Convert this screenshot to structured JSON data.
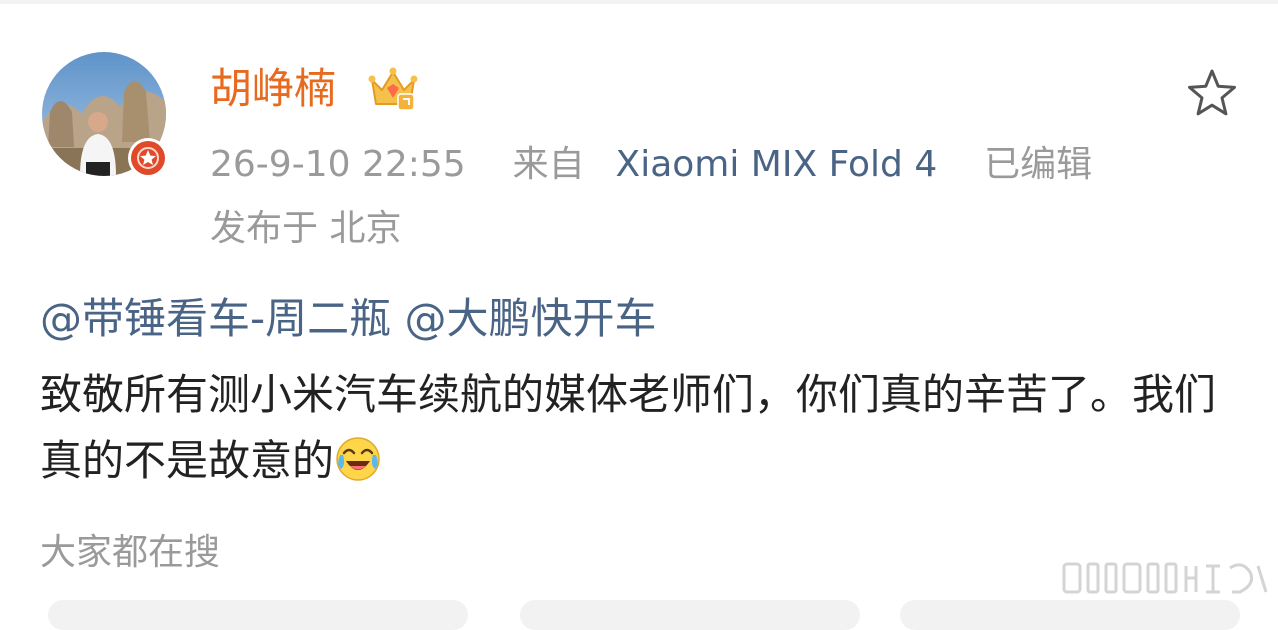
{
  "post": {
    "author": {
      "name": "胡峥楠",
      "avatar_icon": "user-avatar",
      "badge_icon": "verified-badge-icon",
      "crown_icon": "member-crown-icon"
    },
    "meta": {
      "time": "26-9-10 22:55",
      "from_label": "来自",
      "source": "Xiaomi MIX Fold 4",
      "edited": "已编辑",
      "location": "发布于 北京"
    },
    "mentions": [
      "@带锤看车-周二瓶",
      "@大鹏快开车"
    ],
    "body": "致敬所有测小米汽车续航的媒体老师们，你们真的辛苦了。我们真的不是故意的",
    "emoji_icon": "laugh-cry-emoji-icon"
  },
  "trending_label": "大家都在搜",
  "colors": {
    "username": "#e86a1f",
    "link": "#4a6486",
    "muted": "#9a9a9a",
    "text": "#222222",
    "badge_red": "#e04a2a"
  }
}
